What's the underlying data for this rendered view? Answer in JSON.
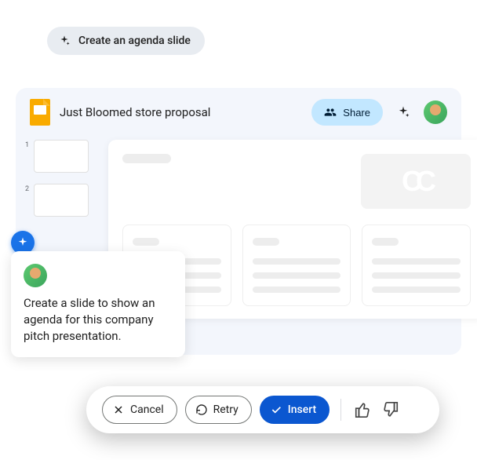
{
  "suggestion": {
    "label": "Create an agenda slide"
  },
  "header": {
    "docTitle": "Just Bloomed store proposal",
    "shareLabel": "Share"
  },
  "thumbnails": [
    {
      "num": "1"
    },
    {
      "num": "2"
    }
  ],
  "prompt": {
    "text": "Create a slide to show an agenda for this company pitch presentation."
  },
  "actions": {
    "cancel": "Cancel",
    "retry": "Retry",
    "insert": "Insert"
  }
}
